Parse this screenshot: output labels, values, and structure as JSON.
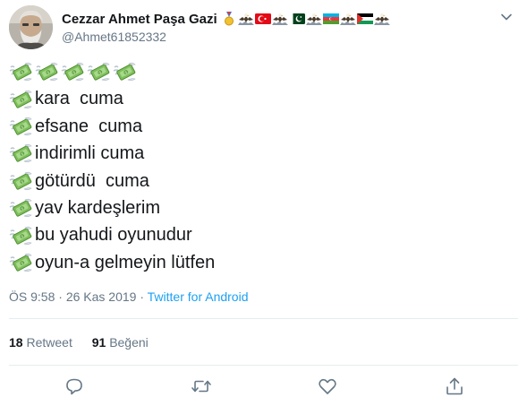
{
  "author": {
    "display_name": "Cezzar Ahmet Paşa Gazi",
    "handle": "@Ahmet61852332",
    "name_emojis": [
      "medal-emoji",
      "eagle-emoji",
      "turkey-flag-emoji",
      "eagle-emoji",
      "pakistan-flag-emoji",
      "eagle-emoji",
      "azerbaijan-flag-emoji",
      "eagle-emoji",
      "palestine-flag-emoji",
      "eagle-emoji"
    ]
  },
  "tweet": {
    "emoji_row_count": 5,
    "lines": [
      "kara  cuma",
      "efsane  cuma",
      "indirimli cuma",
      "götürdü  cuma",
      "yav kardeşlerim",
      "bu yahudi oyunudur",
      "oyun-a gelmeyin lütfen"
    ],
    "line_prefix_icon": "money-with-wings-emoji",
    "time": "ÖS 9:58",
    "date": "26 Kas 2019",
    "separator": "·",
    "source": "Twitter for Android"
  },
  "stats": {
    "retweets_count": "18",
    "retweets_label": "Retweet",
    "likes_count": "91",
    "likes_label": "Beğeni"
  },
  "actions": [
    "reply-icon",
    "retweet-icon",
    "like-icon",
    "share-icon"
  ],
  "colors": {
    "text": "#14171a",
    "secondary": "#657786",
    "link": "#1da1f2",
    "divider": "#e6ecf0"
  }
}
